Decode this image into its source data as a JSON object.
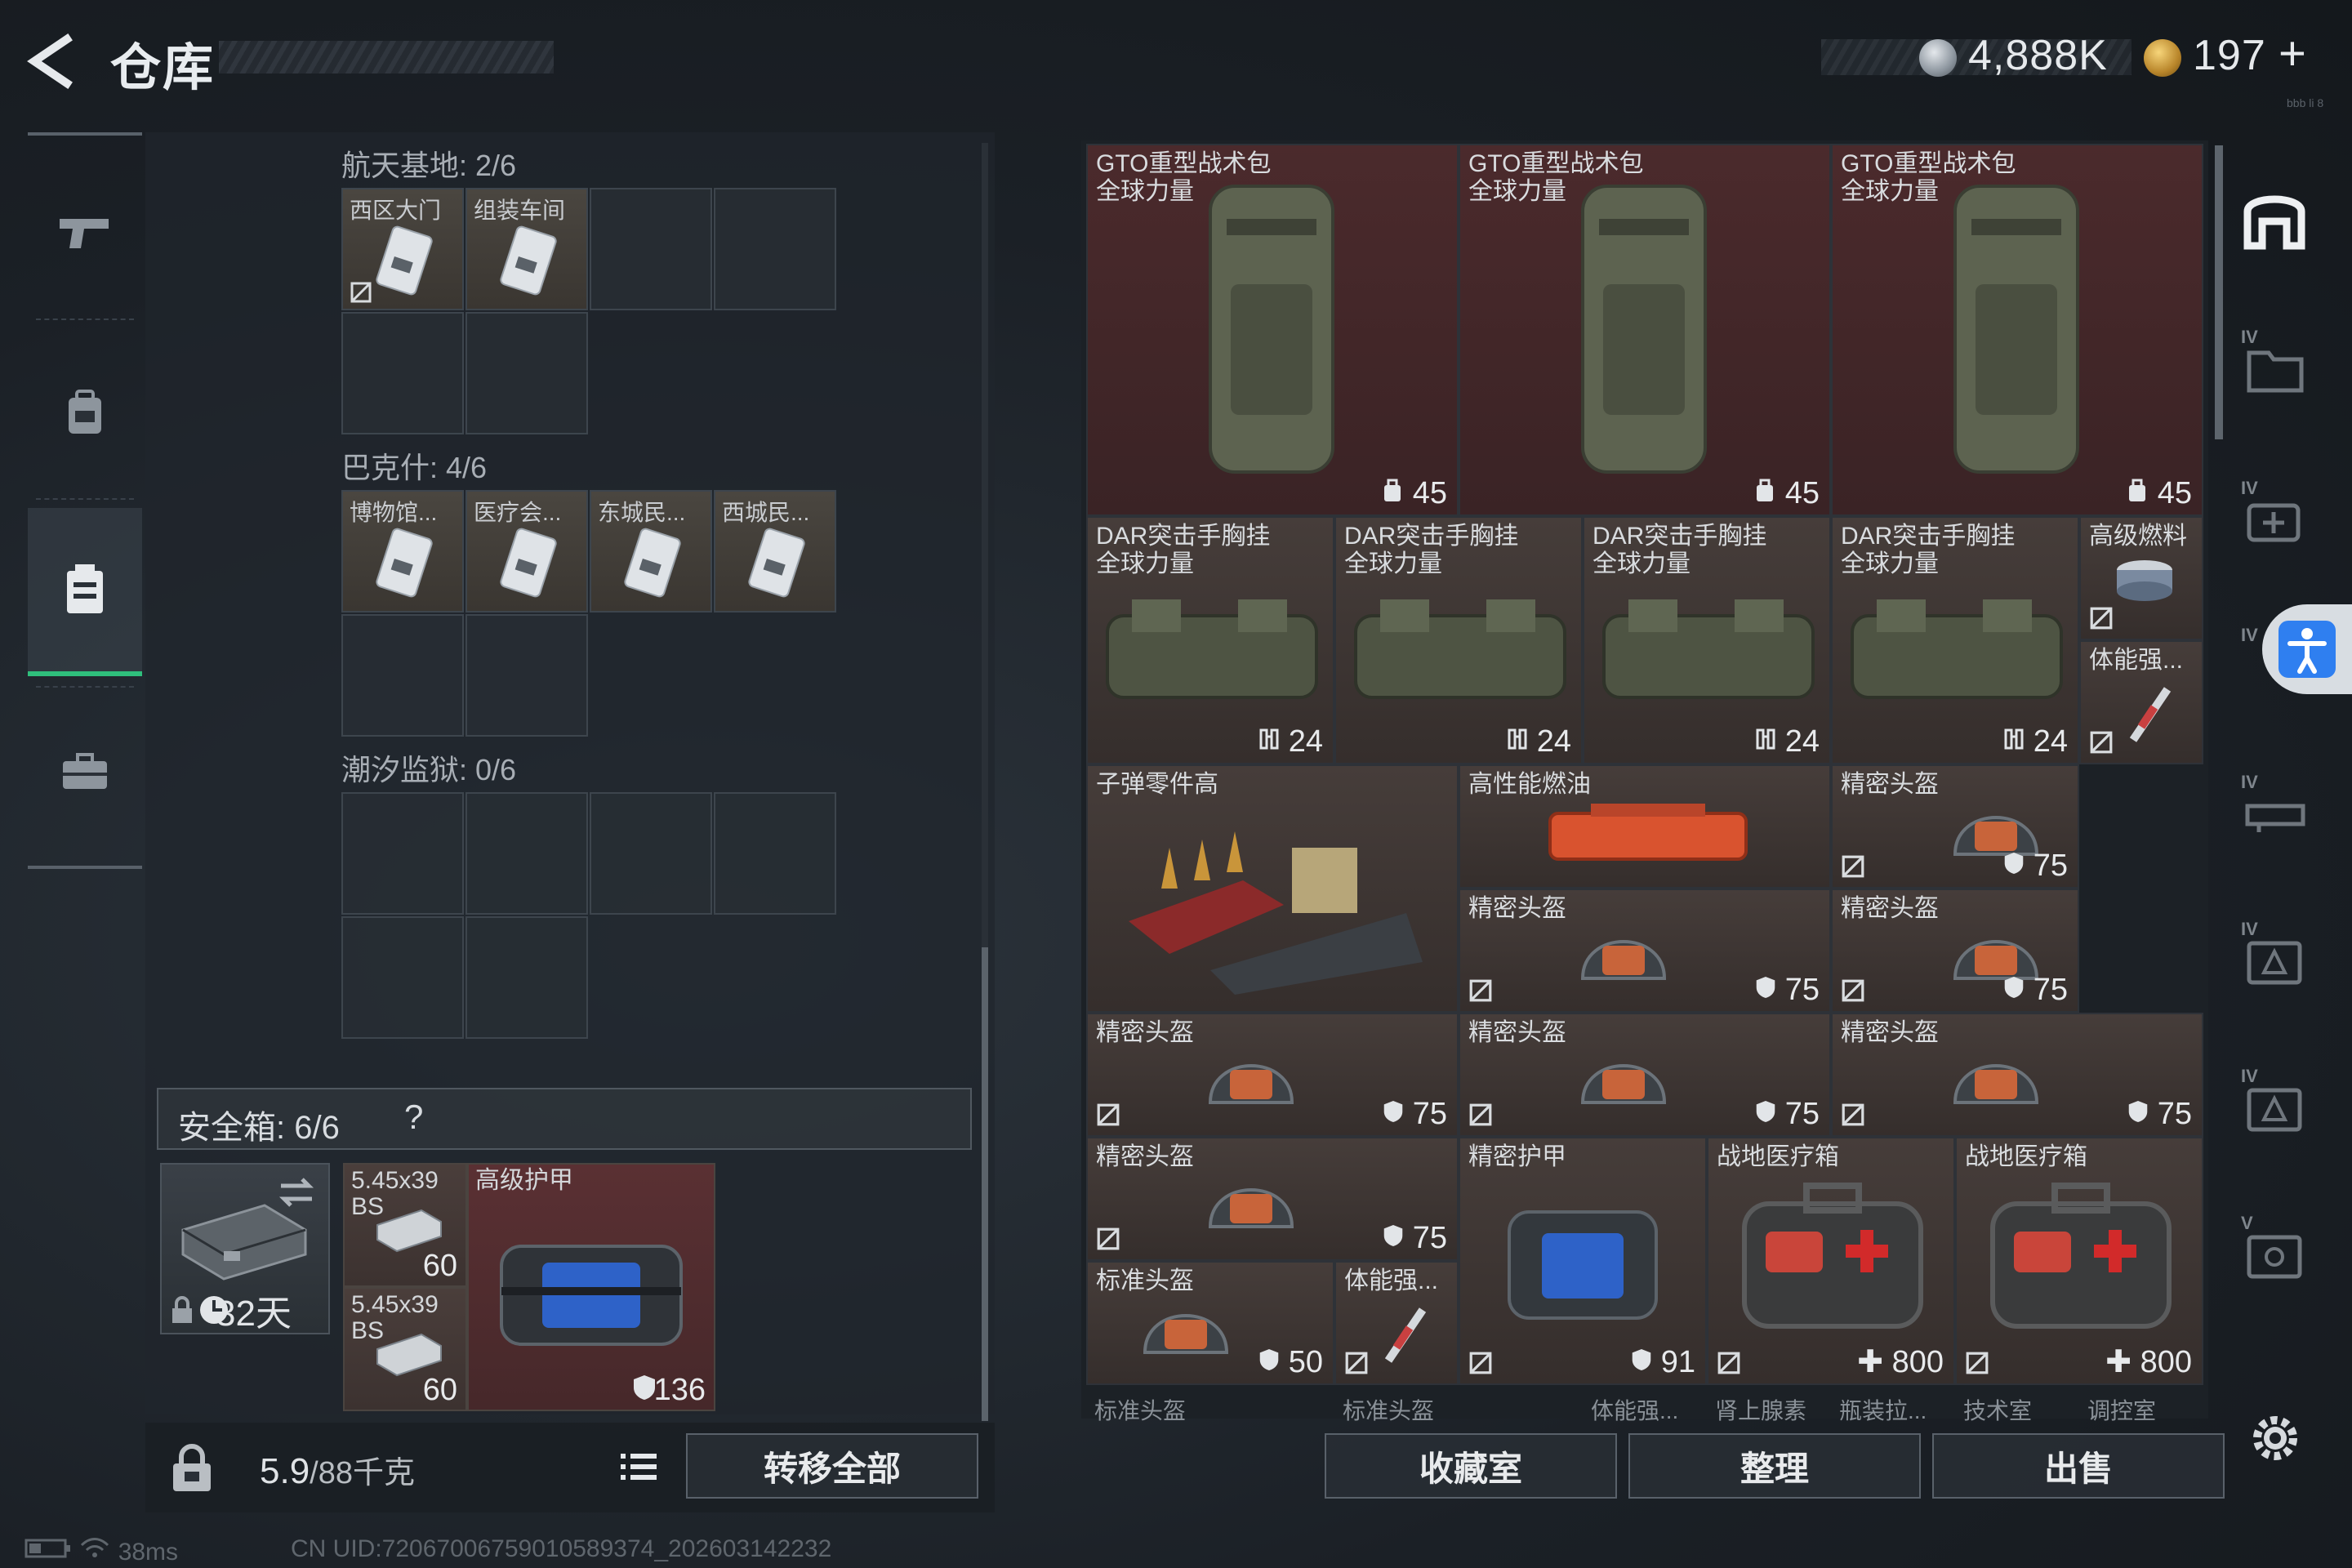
{
  "header": {
    "title": "仓库",
    "currency_1": "4,888K",
    "currency_2": "197",
    "currency_2_add": "+",
    "tiny_code": "bbb li 8"
  },
  "left_nav": {
    "items": [
      "pistol-icon",
      "backpack-icon",
      "vest-icon",
      "case-icon"
    ],
    "active_index": 2,
    "accent_color": "#2fbf7c"
  },
  "regions": [
    {
      "label": "航天基地: 2/6",
      "cards": [
        "西区大门",
        "组装车间"
      ]
    },
    {
      "label": "巴克什: 4/6",
      "cards": [
        "博物馆...",
        "医疗会...",
        "东城民...",
        "西城民..."
      ]
    },
    {
      "label": "潮汐监狱: 0/6",
      "cards": []
    }
  ],
  "safe_box": {
    "label": "安全箱:  6/6",
    "help": "?",
    "days": "32天",
    "ammo_1": {
      "name": "5.45x39\nBS",
      "count": "60"
    },
    "ammo_2": {
      "name": "5.45x39\nBS",
      "count": "60"
    },
    "armor": {
      "name": "高级护甲",
      "durability": "136"
    }
  },
  "bottom_left": {
    "weight": "5.9",
    "weight_unit": "/88千克",
    "transfer_all": "转移全部"
  },
  "grid": {
    "backpacks": [
      {
        "name": "GTO重型战术包\n全球力量",
        "capacity": "45"
      },
      {
        "name": "GTO重型战术包\n全球力量",
        "capacity": "45"
      },
      {
        "name": "GTO重型战术包\n全球力量",
        "capacity": "45"
      }
    ],
    "rigs": [
      {
        "name": "DAR突击手胸挂\n全球力量",
        "capacity": "24"
      },
      {
        "name": "DAR突击手胸挂\n全球力量",
        "capacity": "24"
      },
      {
        "name": "DAR突击手胸挂\n全球力量",
        "capacity": "24"
      },
      {
        "name": "DAR突击手胸挂\n全球力量",
        "capacity": "24"
      }
    ],
    "fuel_small": "高级燃料",
    "stim_small": "体能强...",
    "ammo_parts": "子弹零件高",
    "hp_fuel": "高性能燃油",
    "helmet_name": "精密头盔",
    "helmet_dur": "75",
    "armor_name": "精密护甲",
    "armor_dur": "91",
    "std_helmet": {
      "name": "标准头盔",
      "dur": "50"
    },
    "stim_2": "体能强...",
    "medkits": [
      {
        "name": "战地医疗箱",
        "value": "800"
      },
      {
        "name": "战地医疗箱",
        "value": "800"
      }
    ],
    "bottom_strip": [
      "标准头盔",
      "标准头盔",
      "体能强...",
      "肾上腺素",
      "瓶装拉...",
      "技术室",
      "调控室"
    ]
  },
  "actions": {
    "collection": "收藏室",
    "sort": "整理",
    "sell": "出售"
  },
  "side_bar": {
    "items": [
      "IV",
      "IV",
      "IV",
      "IV",
      "IV",
      "IV",
      "V"
    ]
  },
  "status": {
    "ping": "38ms",
    "uid": "CN UID:72067006759010589374_202603142232"
  }
}
